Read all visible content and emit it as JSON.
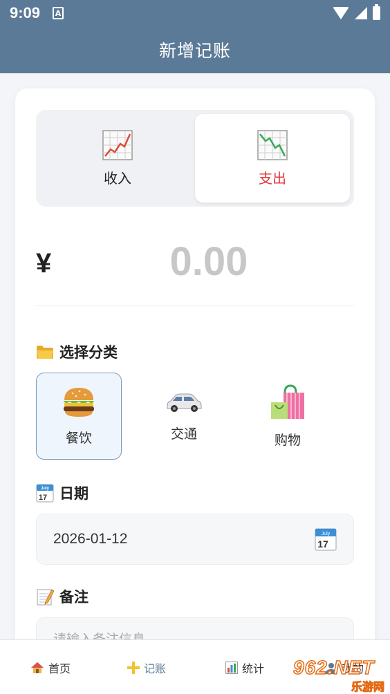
{
  "status_bar": {
    "time": "9:09",
    "a_icon": "A"
  },
  "app_bar": {
    "title": "新增记账"
  },
  "type_toggle": {
    "income": {
      "label": "收入",
      "icon": "chart-increasing-icon"
    },
    "expense": {
      "label": "支出",
      "icon": "chart-decreasing-icon",
      "selected": true
    }
  },
  "amount": {
    "currency": "¥",
    "placeholder": "0.00"
  },
  "category": {
    "title": "选择分类",
    "icon": "folder-icon",
    "items": [
      {
        "label": "餐饮",
        "icon": "hamburger-icon",
        "selected": true
      },
      {
        "label": "交通",
        "icon": "car-icon",
        "selected": false
      },
      {
        "label": "购物",
        "icon": "shopping-bags-icon",
        "selected": false
      }
    ]
  },
  "date": {
    "title": "日期",
    "value": "2026-01-12",
    "icon": "calendar-icon",
    "cal_month": "July",
    "cal_day": "17"
  },
  "note": {
    "title": "备注",
    "placeholder": "请输入备注信息",
    "icon": "memo-icon"
  },
  "bottom_nav": {
    "items": [
      {
        "label": "首页",
        "icon": "house-icon"
      },
      {
        "label": "记账",
        "icon": "plus-icon",
        "active": true
      },
      {
        "label": "统计",
        "icon": "bar-chart-icon"
      },
      {
        "label": "我的",
        "icon": "user-icon"
      }
    ]
  },
  "watermark": {
    "top": "962.NET",
    "bottom": "乐游网"
  },
  "colors": {
    "primary": "#5b7a97",
    "expense": "#e03a3a",
    "selected_bg": "#eef5fd"
  }
}
